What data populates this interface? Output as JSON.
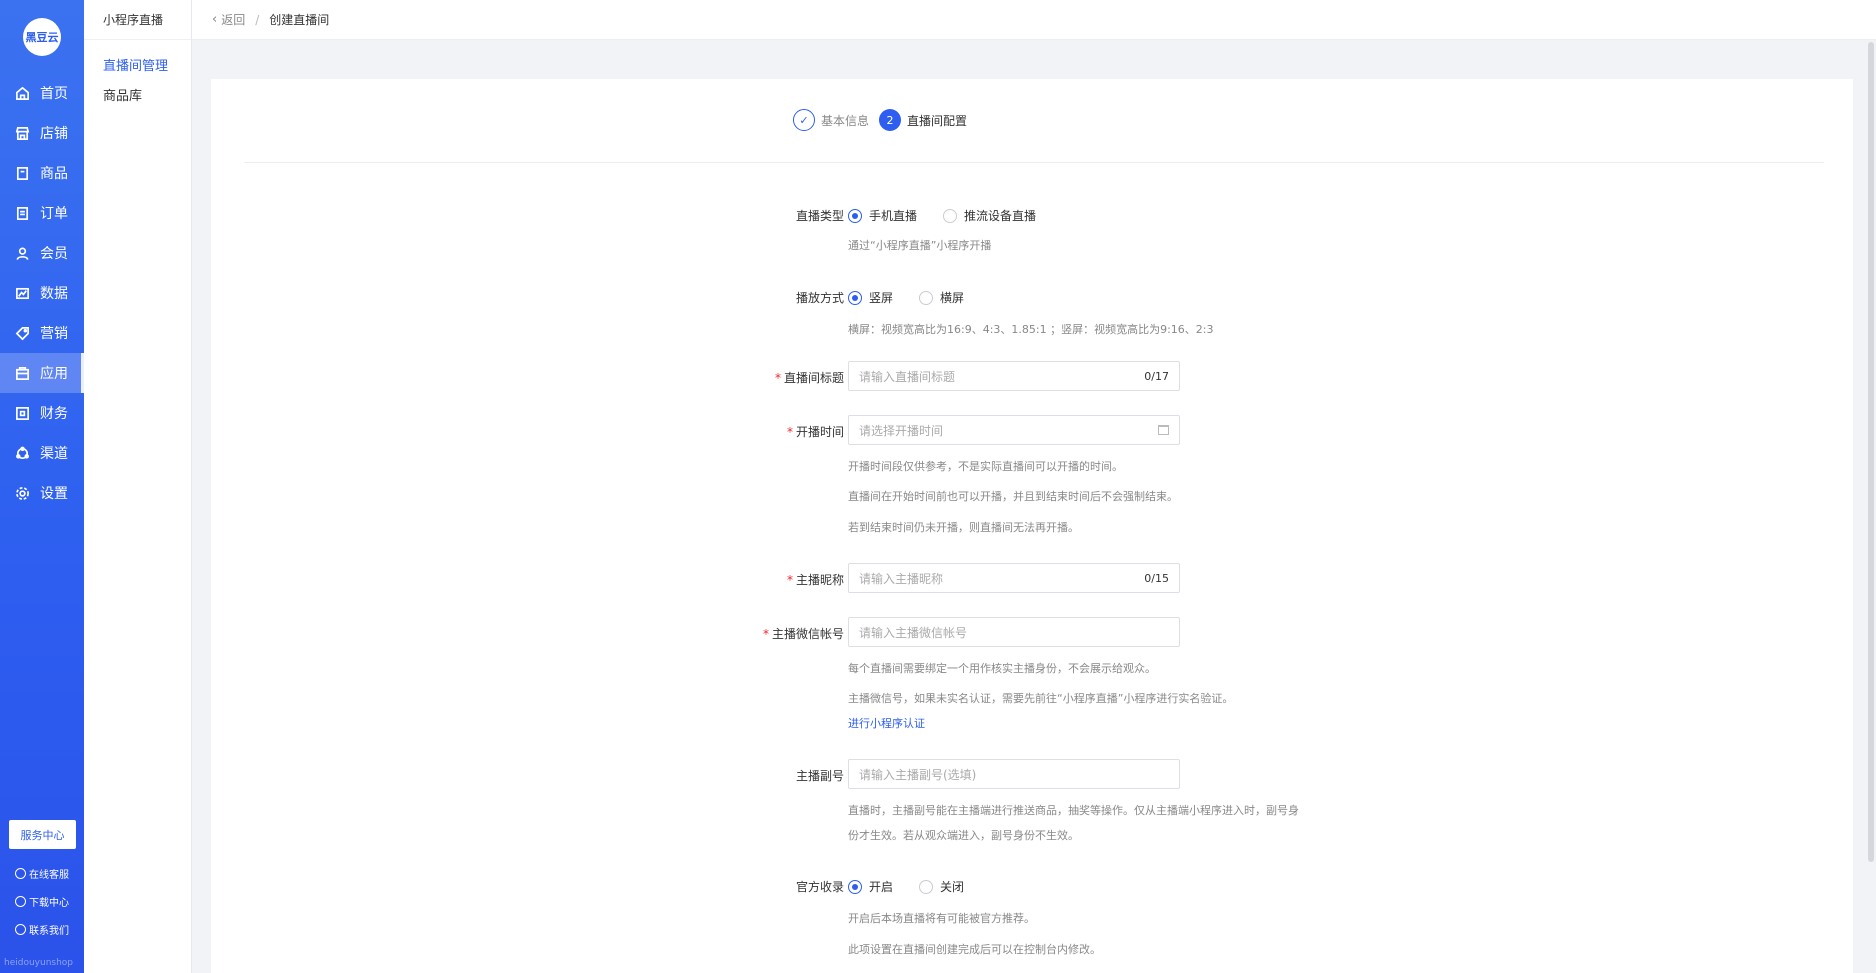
{
  "brand": {
    "logo_text": "黑豆云",
    "watermark": "heidouyunshop"
  },
  "sidebar": {
    "items": [
      {
        "label": "首页",
        "icon": "home-icon"
      },
      {
        "label": "店铺",
        "icon": "store-icon"
      },
      {
        "label": "商品",
        "icon": "goods-icon"
      },
      {
        "label": "订单",
        "icon": "order-icon"
      },
      {
        "label": "会员",
        "icon": "member-icon"
      },
      {
        "label": "数据",
        "icon": "data-icon"
      },
      {
        "label": "营销",
        "icon": "tag-icon"
      },
      {
        "label": "应用",
        "icon": "app-icon",
        "active": true
      },
      {
        "label": "财务",
        "icon": "finance-icon"
      },
      {
        "label": "渠道",
        "icon": "channel-icon"
      },
      {
        "label": "设置",
        "icon": "gear-icon"
      }
    ],
    "service_center": "服务中心",
    "online_service": "在线客服",
    "download_center": "下载中心",
    "contact_us": "联系我们"
  },
  "subside": {
    "title": "小程序直播",
    "items": [
      "直播间管理",
      "商品库"
    ]
  },
  "header": {
    "back": "返回",
    "separator": "/",
    "current": "创建直播间"
  },
  "steps": [
    {
      "num": "✓",
      "label": "基本信息",
      "state": "done"
    },
    {
      "num": "2",
      "label": "直播间配置",
      "state": "current"
    }
  ],
  "form": {
    "live_type": {
      "label": "直播类型",
      "options": [
        "手机直播",
        "推流设备直播"
      ],
      "selected": "手机直播",
      "help": "通过“小程序直播”小程序开播"
    },
    "play_mode": {
      "label": "播放方式",
      "options": [
        "竖屏",
        "横屏"
      ],
      "selected": "竖屏",
      "help": "横屏：视频宽高比为16:9、4:3、1.85:1 ；竖屏：视频宽高比为9:16、2:3"
    },
    "room_title": {
      "label": "直播间标题",
      "placeholder": "请输入直播间标题",
      "count": "0/17"
    },
    "start_time": {
      "label": "开播时间",
      "placeholder": "请选择开播时间",
      "help": [
        "开播时间段仅供参考，不是实际直播间可以开播的时间。",
        "直播间在开始时间前也可以开播，并且到结束时间后不会强制结束。",
        "若到结束时间仍未开播，则直播间无法再开播。"
      ]
    },
    "anchor_nickname": {
      "label": "主播昵称",
      "placeholder": "请输入主播昵称",
      "count": "0/15"
    },
    "anchor_wechat": {
      "label": "主播微信帐号",
      "placeholder": "请输入主播微信帐号",
      "help": [
        "每个直播间需要绑定一个用作核实主播身份，不会展示给观众。",
        "主播微信号，如果未实名认证，需要先前往“小程序直播”小程序进行实名验证。"
      ],
      "link": "进行小程序认证"
    },
    "anchor_sub": {
      "label": "主播副号",
      "placeholder": "请输入主播副号(选填)",
      "help": [
        "直播时，主播副号能在主播端进行推送商品，抽奖等操作。仅从主播端小程序进入时，副号身",
        "份才生效。若从观众端进入，副号身份不生效。"
      ]
    },
    "official": {
      "label": "官方收录",
      "options": [
        "开启",
        "关闭"
      ],
      "selected": "开启",
      "help": [
        "开启后本场直播将有可能被官方推荐。",
        "此项设置在直播间创建完成后可以在控制台内修改。"
      ]
    }
  },
  "colors": {
    "primary": "#2d5ef0",
    "required": "#f5222d"
  }
}
